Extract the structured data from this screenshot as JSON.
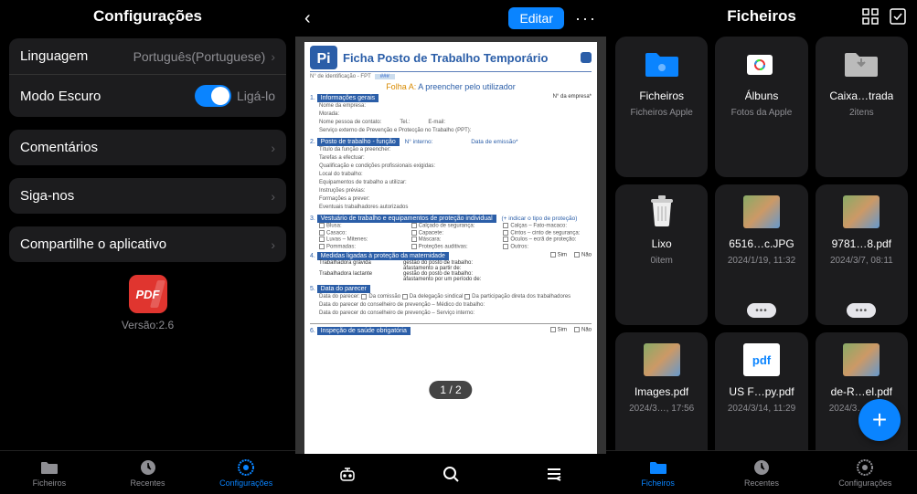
{
  "panel1": {
    "title": "Configurações",
    "language": {
      "label": "Linguagem",
      "value": "Português(Portuguese)"
    },
    "darkmode": {
      "label": "Modo Escuro",
      "hint": "Ligá-lo"
    },
    "comments": {
      "label": "Comentários"
    },
    "follow": {
      "label": "Siga-nos"
    },
    "share": {
      "label": "Compartilhe o aplicativo"
    },
    "app_icon_text": "PDF",
    "version": "Versão:2.6",
    "tabs": {
      "files": "Ficheiros",
      "recent": "Recentes",
      "settings": "Configurações"
    }
  },
  "panel2": {
    "edit": "Editar",
    "doc": {
      "logo": "Pi",
      "title": "Ficha Posto de Trabalho Temporário",
      "ident_label": "N° de identificação - FPT",
      "ident_value": "###",
      "folha_a": "Folha A:",
      "folha_a_sub": "A preencher pelo utilizador",
      "sections": {
        "s1": {
          "num": "1.",
          "title": "Informações gerais",
          "fields": [
            "Nome da empresa:",
            "Morada:",
            "Nome pessoa de contato:",
            "Tel.:",
            "E-mail:",
            "Serviço externo de Prevenção e Protecção no Trabalho (PPT):"
          ],
          "right": "N° da empresa*"
        },
        "s2": {
          "num": "2.",
          "title": "Posto de trabalho - função",
          "mid": "N° interno:",
          "extra": "Data de emissão*",
          "fields": [
            "Título da função a preencher:",
            "Tarefas a efectuar:",
            "Qualificação e condições profissionais exigidas:",
            "Local do trabalho:",
            "Equipamentos de trabalho a utilizar:",
            "Instruções prévias:",
            "Formações a prever:",
            "Eventuais trabalhadores autorizados"
          ]
        },
        "s3": {
          "num": "3.",
          "title": "Vestuário de trabalho e equipamentos de proteção individual",
          "extra": "(+ indicar o tipo de proteção)",
          "checks": [
            "Blusa:",
            "Calçado de segurança:",
            "Calças – Fato-macaco:",
            "Casaco:",
            "Capacete:",
            "Cintos – cinto de segurança:",
            "Luvas – Mitenes:",
            "Máscara:",
            "Óculos – ecrã de proteção:",
            "Pommadas:",
            "Proteções auditivas:",
            "Outros:"
          ]
        },
        "s4": {
          "num": "4.",
          "title": "Medidas ligadas à proteção da maternidade",
          "rows": [
            {
              "a": "Trabalhadora grávida",
              "b": "gestão do posto de trabalho:"
            },
            {
              "a": "",
              "b": "afastamento a partir de:"
            },
            {
              "a": "Trabalhadora lactante",
              "b": "gestão do posto de trabalho:"
            },
            {
              "a": "",
              "b": "afastamento por um período de:"
            }
          ],
          "sim": "Sim",
          "nao": "Não"
        },
        "s5": {
          "num": "5.",
          "title": "Data do parecer",
          "line1": "Data do parecer:",
          "opts": [
            "Da comissão",
            "Da delegação sindical",
            "Da participação direta dos trabalhadores"
          ],
          "line2": "Data do parecer do conselheiro de prevenção – Médico do trabalho:",
          "line3": "Data do parecer do conselheiro de prevenção – Serviço interno:"
        },
        "s6": {
          "num": "6.",
          "title": "Inspeção de saúde obrigatória",
          "sim": "Sim",
          "nao": "Não"
        }
      },
      "page_indicator": "1 / 2"
    }
  },
  "panel3": {
    "title": "Ficheiros",
    "items": [
      {
        "name": "Ficheiros",
        "sub": "Ficheiros Apple",
        "kind": "folder",
        "color": "#0a84ff"
      },
      {
        "name": "Álbuns",
        "sub": "Fotos da Apple",
        "kind": "albums"
      },
      {
        "name": "Caixa…trada",
        "sub": "2itens",
        "kind": "inbox"
      },
      {
        "name": "Lixo",
        "sub": "0item",
        "kind": "trash"
      },
      {
        "name": "6516…c.JPG",
        "sub": "2024/1/19, 11:32",
        "kind": "file",
        "more": true
      },
      {
        "name": "9781…8.pdf",
        "sub": "2024/3/7, 08:11",
        "kind": "file",
        "more": true
      },
      {
        "name": "Images.pdf",
        "sub": "2024/3…, 17:56",
        "kind": "file",
        "more": true
      },
      {
        "name": "US F…py.pdf",
        "sub": "2024/3/14, 11:29",
        "kind": "pdf",
        "more": true
      },
      {
        "name": "de-R…el.pdf",
        "sub": "2024/3…, 14:55",
        "kind": "file",
        "more": true
      }
    ],
    "tabs": {
      "files": "Ficheiros",
      "recent": "Recentes",
      "settings": "Configurações"
    }
  }
}
